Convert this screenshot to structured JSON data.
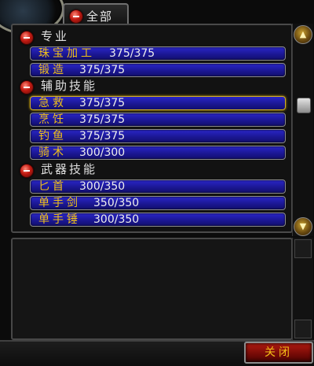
{
  "top_tab": {
    "label": "全部"
  },
  "skill_groups": [
    {
      "header": "专业",
      "skills": [
        {
          "name": "珠宝加工",
          "value": "375/375"
        },
        {
          "name": "锻造",
          "value": "375/375"
        }
      ]
    },
    {
      "header": "辅助技能",
      "skills": [
        {
          "name": "急救",
          "value": "375/375",
          "highlight": true
        },
        {
          "name": "烹饪",
          "value": "375/375"
        },
        {
          "name": "钓鱼",
          "value": "375/375"
        },
        {
          "name": "骑术",
          "value": "300/300"
        }
      ]
    },
    {
      "header": "武器技能",
      "skills": [
        {
          "name": "匕首",
          "value": "300/350"
        },
        {
          "name": "单手剑",
          "value": "350/350"
        },
        {
          "name": "单手锤",
          "value": "300/350"
        }
      ]
    }
  ],
  "flat": {
    "h0": "专业",
    "s0n": "珠宝加工",
    "s0v": "375/375",
    "s1n": "锻造",
    "s1v": "375/375",
    "h1": "辅助技能",
    "s2n": "急救",
    "s2v": "375/375",
    "s3n": "烹饪",
    "s3v": "375/375",
    "s4n": "钓鱼",
    "s4v": "375/375",
    "s5n": "骑术",
    "s5v": "300/300",
    "h2": "武器技能",
    "s6n": "匕首",
    "s6v": "300/350",
    "s7n": "单手剑",
    "s7v": "350/350",
    "s8n": "单手锤",
    "s8v": "300/350"
  },
  "close_button": {
    "label": "关闭"
  },
  "colors": {
    "skill_name": "#f0c018",
    "skill_value": "#ececec",
    "bar_fill": "#1a1690",
    "highlight_border": "#d4b020",
    "close_button": "#8a0d07"
  },
  "icons": {
    "collapse": "minus-circle-icon",
    "scroll_up": "scroll-up-arrow-icon",
    "scroll_down": "scroll-down-arrow-icon"
  }
}
